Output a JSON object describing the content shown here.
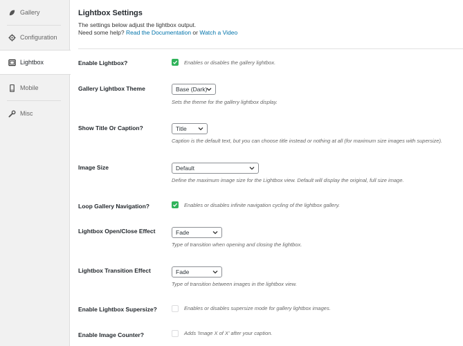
{
  "sidebar": {
    "tabs": [
      {
        "label": "Gallery",
        "icon": "leaf-icon"
      },
      {
        "label": "Configuration",
        "icon": "gear-icon"
      },
      {
        "label": "Lightbox",
        "icon": "lightbox-icon"
      },
      {
        "label": "Mobile",
        "icon": "mobile-icon"
      },
      {
        "label": "Misc",
        "icon": "wrench-icon"
      }
    ],
    "active": "Lightbox"
  },
  "header": {
    "title": "Lightbox Settings",
    "description": "The settings below adjust the lightbox output.",
    "help_prefix": "Need some help?",
    "doc_link": "Read the Documentation",
    "or_text": "or",
    "video_link": "Watch a Video"
  },
  "settings": {
    "enable_lightbox": {
      "label": "Enable Lightbox?",
      "checked": true,
      "help": "Enables or disables the gallery lightbox."
    },
    "theme": {
      "label": "Gallery Lightbox Theme",
      "value": "Base (Dark)",
      "help": "Sets the theme for the gallery lightbox display."
    },
    "title_caption": {
      "label": "Show Title Or Caption?",
      "value": "Title",
      "help": "Caption is the default text, but you can choose title instead or nothing at all (for maximum size images with supersize)."
    },
    "image_size": {
      "label": "Image Size",
      "value": "Default",
      "help": "Define the maximum image size for the Lightbox view. Default will display the original, full size image."
    },
    "loop_navigation": {
      "label": "Loop Gallery Navigation?",
      "checked": true,
      "help": "Enables or disables infinite navigation cycling of the lightbox gallery."
    },
    "open_close_effect": {
      "label": "Lightbox Open/Close Effect",
      "value": "Fade",
      "help": "Type of transition when opening and closing the lightbox."
    },
    "transition_effect": {
      "label": "Lightbox Transition Effect",
      "value": "Fade",
      "help": "Type of transition between images in the lightbox view."
    },
    "supersize": {
      "label": "Enable Lightbox Supersize?",
      "checked": false,
      "help": "Enables or disables supersize mode for gallery lightbox images."
    },
    "image_counter": {
      "label": "Enable Image Counter?",
      "checked": false,
      "help": "Adds 'Image X of X' after your caption."
    }
  },
  "colors": {
    "accent": "#0073aa",
    "checkbox_checked": "#30b35a",
    "sidebar_bg": "#f1f1f1"
  }
}
